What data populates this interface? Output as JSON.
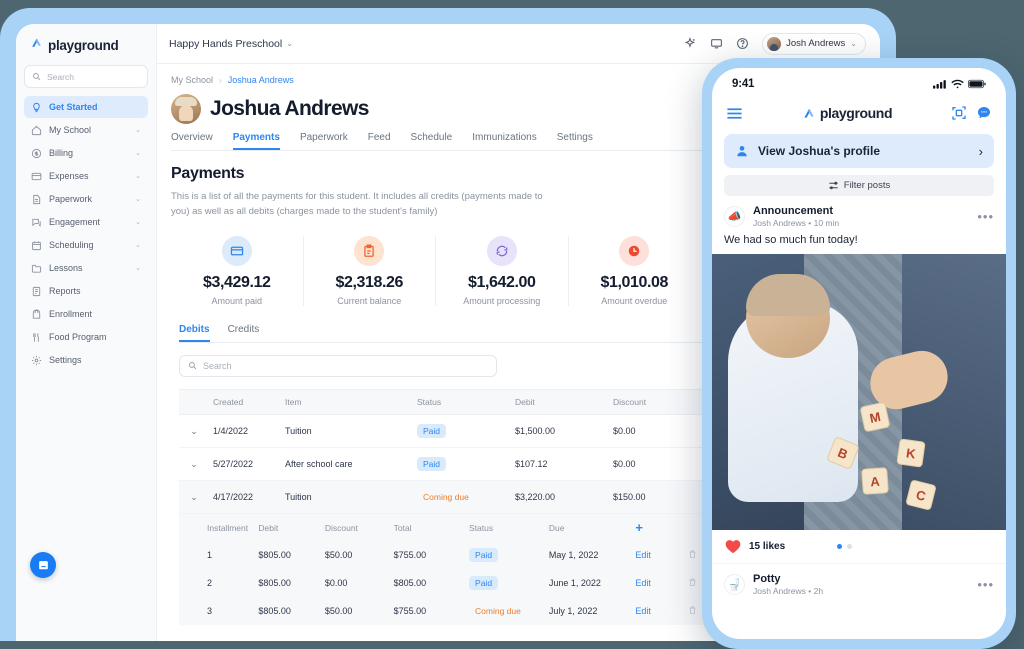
{
  "tablet": {
    "sidebar": {
      "brand": "playground",
      "search_placeholder": "Search",
      "items": [
        {
          "label": "Get Started",
          "icon": "lightbulb-icon",
          "active": true,
          "expandable": false
        },
        {
          "label": "My School",
          "icon": "home-icon",
          "active": false,
          "expandable": true
        },
        {
          "label": "Billing",
          "icon": "dollar-icon",
          "active": false,
          "expandable": true
        },
        {
          "label": "Expenses",
          "icon": "card-icon",
          "active": false,
          "expandable": true
        },
        {
          "label": "Paperwork",
          "icon": "document-icon",
          "active": false,
          "expandable": true
        },
        {
          "label": "Engagement",
          "icon": "chat-icon",
          "active": false,
          "expandable": true
        },
        {
          "label": "Scheduling",
          "icon": "calendar-icon",
          "active": false,
          "expandable": true
        },
        {
          "label": "Lessons",
          "icon": "folder-icon",
          "active": false,
          "expandable": true
        },
        {
          "label": "Reports",
          "icon": "report-icon",
          "active": false,
          "expandable": false
        },
        {
          "label": "Enrollment",
          "icon": "backpack-icon",
          "active": false,
          "expandable": false
        },
        {
          "label": "Food Program",
          "icon": "utensils-icon",
          "active": false,
          "expandable": false
        },
        {
          "label": "Settings",
          "icon": "gear-icon",
          "active": false,
          "expandable": false
        }
      ]
    },
    "topbar": {
      "school": "Happy Hands Preschool",
      "user": "Josh Andrews"
    },
    "breadcrumb": {
      "root": "My School",
      "current": "Joshua Andrews"
    },
    "page_title": "Joshua Andrews",
    "tabs": [
      {
        "label": "Overview",
        "active": false
      },
      {
        "label": "Payments",
        "active": true
      },
      {
        "label": "Paperwork",
        "active": false
      },
      {
        "label": "Feed",
        "active": false
      },
      {
        "label": "Schedule",
        "active": false
      },
      {
        "label": "Immunizations",
        "active": false
      },
      {
        "label": "Settings",
        "active": false
      }
    ],
    "section": {
      "title": "Payments",
      "description": "This is a list of all the payments for this student. It includes all credits (payments made to you) as well as all debits (charges made to the student's family)"
    },
    "stats": [
      {
        "value": "$3,429.12",
        "label": "Amount paid",
        "icon": "credit-card-icon",
        "bg": "#dcebfb",
        "fg": "#2f86ef"
      },
      {
        "value": "$2,318.26",
        "label": "Current balance",
        "icon": "clipboard-icon",
        "bg": "#fde3d0",
        "fg": "#f0642e"
      },
      {
        "value": "$1,642.00",
        "label": "Amount processing",
        "icon": "refresh-icon",
        "bg": "#e8e2fb",
        "fg": "#7a6bd6"
      },
      {
        "value": "$1,010.08",
        "label": "Amount overdue",
        "icon": "clock-icon",
        "bg": "#fde0da",
        "fg": "#f0492e"
      }
    ],
    "subtabs": [
      {
        "label": "Debits",
        "active": true
      },
      {
        "label": "Credits",
        "active": false
      }
    ],
    "table_search_placeholder": "Search",
    "table": {
      "headers": [
        "",
        "Created",
        "Item",
        "Status",
        "Debit",
        "Discount"
      ],
      "rows": [
        {
          "created": "1/4/2022",
          "item": "Tuition",
          "status": "Paid",
          "status_kind": "paid",
          "debit": "$1,500.00",
          "discount": "$0.00",
          "expanded": false
        },
        {
          "created": "5/27/2022",
          "item": "After school care",
          "status": "Paid",
          "status_kind": "paid",
          "debit": "$107.12",
          "discount": "$0.00",
          "expanded": false
        },
        {
          "created": "4/17/2022",
          "item": "Tuition",
          "status": "Coming due",
          "status_kind": "due",
          "debit": "$3,220.00",
          "discount": "$150.00",
          "expanded": true
        }
      ]
    },
    "installments": {
      "headers": [
        "Installment",
        "Debit",
        "Discount",
        "Total",
        "Status",
        "Due",
        "+"
      ],
      "add_label": "+",
      "edit_label": "Edit",
      "rows": [
        {
          "n": "1",
          "debit": "$805.00",
          "discount": "$50.00",
          "total": "$755.00",
          "status": "Paid",
          "status_kind": "paid",
          "due": "May 1, 2022"
        },
        {
          "n": "2",
          "debit": "$805.00",
          "discount": "$0.00",
          "total": "$805.00",
          "status": "Paid",
          "status_kind": "paid",
          "due": "June 1, 2022"
        },
        {
          "n": "3",
          "debit": "$805.00",
          "discount": "$50.00",
          "total": "$755.00",
          "status": "Coming due",
          "status_kind": "due",
          "due": "July 1, 2022"
        }
      ]
    }
  },
  "phone": {
    "status_time": "9:41",
    "brand": "playground",
    "profile_button": "View Joshua's profile",
    "filter_button": "Filter posts",
    "posts": [
      {
        "title": "Announcement",
        "icon": "megaphone-icon",
        "meta": "Josh Andrews • 10 min",
        "body": "We had so much fun today!",
        "likes": "15 likes"
      },
      {
        "title": "Potty",
        "icon": "toilet-icon",
        "meta": "Josh Andrews • 2h"
      }
    ]
  },
  "colors": {
    "accent": "#2f86ef",
    "device_frame": "#a8d3f7",
    "canvas": "#4d6670"
  }
}
